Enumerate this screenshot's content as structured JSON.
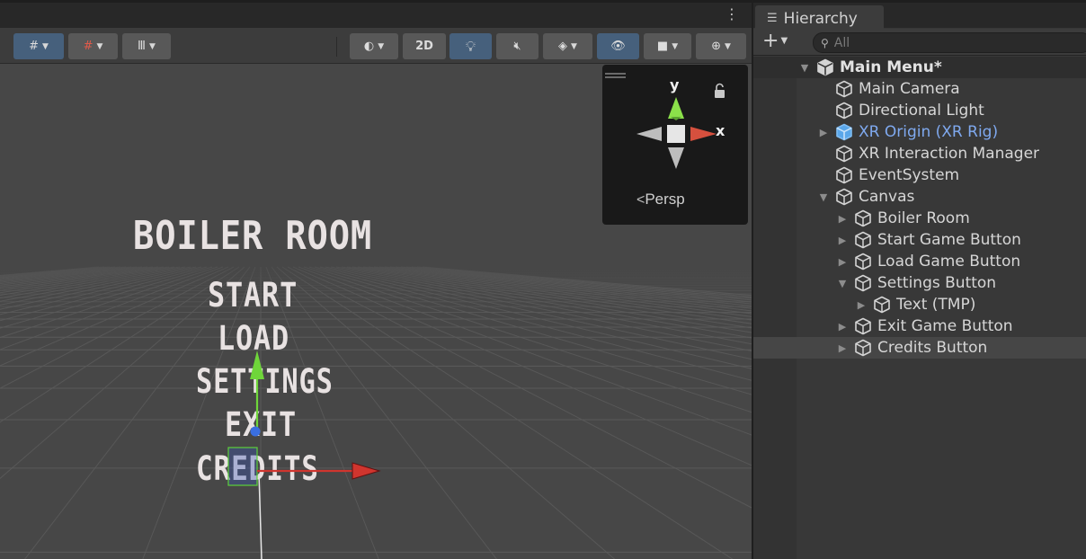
{
  "scene_view": {
    "toolbar": {
      "view_2d_label": "2D"
    },
    "gizmo": {
      "axis_y": "y",
      "axis_x": "x",
      "projection_label": "Persp"
    },
    "menu_texts": {
      "title": "BOILER ROOM",
      "start": "START",
      "load": "LOAD",
      "settings": "SETTINGS",
      "exit": "EXIT",
      "credits": "CREDITS"
    }
  },
  "hierarchy": {
    "tab_title": "Hierarchy",
    "search_placeholder": "All",
    "items": [
      {
        "label": "Main Menu*",
        "depth": 0,
        "expander": "expanded",
        "type": "scene"
      },
      {
        "label": "Main Camera",
        "depth": 1,
        "expander": "none",
        "type": "object"
      },
      {
        "label": "Directional Light",
        "depth": 1,
        "expander": "none",
        "type": "object"
      },
      {
        "label": "XR Origin (XR Rig)",
        "depth": 1,
        "expander": "collapsed",
        "type": "prefab"
      },
      {
        "label": "XR Interaction Manager",
        "depth": 1,
        "expander": "none",
        "type": "object"
      },
      {
        "label": "EventSystem",
        "depth": 1,
        "expander": "none",
        "type": "object"
      },
      {
        "label": "Canvas",
        "depth": 1,
        "expander": "expanded",
        "type": "object"
      },
      {
        "label": "Boiler Room",
        "depth": 2,
        "expander": "collapsed",
        "type": "object"
      },
      {
        "label": "Start Game Button",
        "depth": 2,
        "expander": "collapsed",
        "type": "object"
      },
      {
        "label": "Load Game Button",
        "depth": 2,
        "expander": "collapsed",
        "type": "object"
      },
      {
        "label": "Settings Button",
        "depth": 2,
        "expander": "expanded",
        "type": "object"
      },
      {
        "label": "Text (TMP)",
        "depth": 3,
        "expander": "collapsed",
        "type": "object"
      },
      {
        "label": "Exit Game Button",
        "depth": 2,
        "expander": "collapsed",
        "type": "object"
      },
      {
        "label": "Credits Button",
        "depth": 2,
        "expander": "collapsed",
        "type": "object",
        "selected": true
      }
    ]
  },
  "colors": {
    "accent_blue": "#46607c",
    "prefab_blue": "#7fa9ef",
    "axis_x": "#d0352e",
    "axis_y": "#6fd63a",
    "axis_z": "#3a6fe0"
  }
}
